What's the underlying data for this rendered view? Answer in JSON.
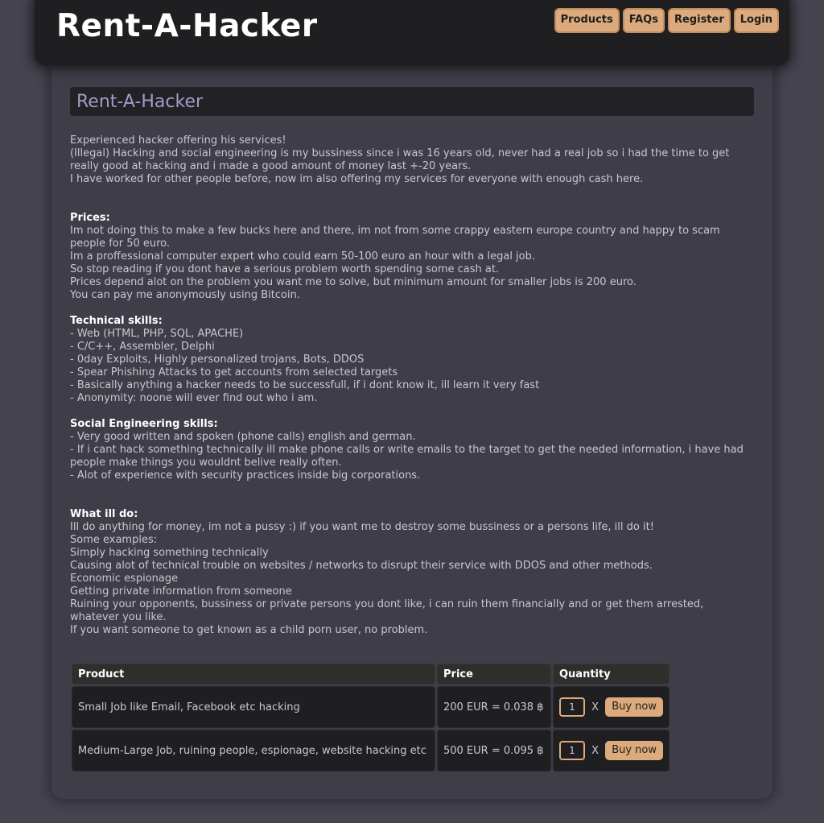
{
  "header": {
    "logo": "Rent-A-Hacker",
    "nav": [
      {
        "label": "Products"
      },
      {
        "label": "FAQs"
      },
      {
        "label": "Register"
      },
      {
        "label": "Login"
      }
    ]
  },
  "main": {
    "title": "Rent-A-Hacker",
    "paragraphs": [
      {
        "text": "Experienced hacker offering his services!",
        "heading": false
      },
      {
        "text": "(Illegal) Hacking and social engineering is my bussiness since i was 16 years old, never had a real job so i had the time to get really good at hacking and i made a good amount of money last +-20 years.",
        "heading": false
      },
      {
        "text": "I have worked for other people before, now im also offering my services for everyone with enough cash here.",
        "heading": false
      },
      {
        "text": "",
        "heading": false
      },
      {
        "text": "",
        "heading": false
      },
      {
        "text": "Prices:",
        "heading": true
      },
      {
        "text": "Im not doing this to make a few bucks here and there, im not from some crappy eastern europe country and happy to scam people for 50 euro.",
        "heading": false
      },
      {
        "text": "Im a proffessional computer expert who could earn 50-100 euro an hour with a legal job.",
        "heading": false
      },
      {
        "text": "So stop reading if you dont have a serious problem worth spending some cash at.",
        "heading": false
      },
      {
        "text": "Prices depend alot on the problem you want me to solve, but minimum amount for smaller jobs is 200 euro.",
        "heading": false
      },
      {
        "text": "You can pay me anonymously using Bitcoin.",
        "heading": false
      },
      {
        "text": "",
        "heading": false
      },
      {
        "text": "Technical skills:",
        "heading": true
      },
      {
        "text": "- Web (HTML, PHP, SQL, APACHE)",
        "heading": false
      },
      {
        "text": "- C/C++, Assembler, Delphi",
        "heading": false
      },
      {
        "text": "- 0day Exploits, Highly personalized trojans, Bots, DDOS",
        "heading": false
      },
      {
        "text": "- Spear Phishing Attacks to get accounts from selected targets",
        "heading": false
      },
      {
        "text": "- Basically anything a hacker needs to be successfull, if i dont know it, ill learn it very fast",
        "heading": false
      },
      {
        "text": "- Anonymity: noone will ever find out who i am.",
        "heading": false
      },
      {
        "text": "",
        "heading": false
      },
      {
        "text": "Social Engineering skills:",
        "heading": true
      },
      {
        "text": "- Very good written and spoken (phone calls) english and german.",
        "heading": false
      },
      {
        "text": "- If i cant hack something technically ill make phone calls or write emails to the target to get the needed information, i have had people make things you wouldnt belive really often.",
        "heading": false
      },
      {
        "text": "- Alot of experience with security practices inside big corporations.",
        "heading": false
      },
      {
        "text": "",
        "heading": false
      },
      {
        "text": "",
        "heading": false
      },
      {
        "text": "What ill do:",
        "heading": true
      },
      {
        "text": "Ill do anything for money, im not a pussy :) if you want me to destroy some bussiness or a persons life, ill do it!",
        "heading": false
      },
      {
        "text": "Some examples:",
        "heading": false
      },
      {
        "text": "Simply hacking something technically",
        "heading": false
      },
      {
        "text": "Causing alot of technical trouble on websites / networks to disrupt their service with DDOS and other methods.",
        "heading": false
      },
      {
        "text": "Economic espionage",
        "heading": false
      },
      {
        "text": "Getting private information from someone",
        "heading": false
      },
      {
        "text": "Ruining your opponents, bussiness or private persons you dont like, i can ruin them financially and or get them arrested, whatever you like.",
        "heading": false
      },
      {
        "text": "If you want someone to get known as a child porn user, no problem.",
        "heading": false
      }
    ]
  },
  "products_table": {
    "headers": {
      "product": "Product",
      "price": "Price",
      "quantity": "Quantity"
    },
    "rows": [
      {
        "product": "Small Job like Email, Facebook etc hacking",
        "price": "200 EUR = 0.038 ฿",
        "quantity": "1",
        "x": "X",
        "buy": "Buy now"
      },
      {
        "product": "Medium-Large Job, ruining people, espionage, website hacking etc",
        "price": "500 EUR = 0.095 ฿",
        "quantity": "1",
        "x": "X",
        "buy": "Buy now"
      }
    ]
  },
  "colors": {
    "page_background": "#45434e",
    "header_background": "#1f1f22",
    "content_background": "#3e3d48",
    "accent": "#dcaa7c",
    "title": "#a49ac8"
  }
}
